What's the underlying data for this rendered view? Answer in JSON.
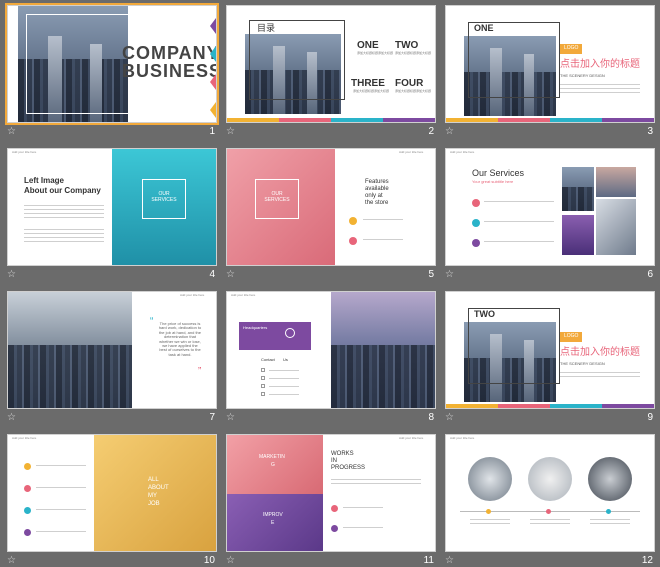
{
  "slides": [
    {
      "num": "1",
      "company": "COMPANY",
      "business": "BUSINESS"
    },
    {
      "num": "2",
      "title": "目录",
      "one": "ONE",
      "two": "TWO",
      "three": "THREE",
      "four": "FOUR",
      "sub": "添加大标题标题添加大标题"
    },
    {
      "num": "3",
      "label": "ONE",
      "logo": "LOGO",
      "cn_title": "点击加入你的标题",
      "subtitle": "THE SCENERY DESIGN"
    },
    {
      "num": "4",
      "header": "Add your title here",
      "title1": "Left Image",
      "title2": "About our Company",
      "box": "OUR SERVICES"
    },
    {
      "num": "5",
      "header": "Add your title here",
      "box": "OUR SERVICES",
      "f1": "Features",
      "f2": "available",
      "f3": "only at",
      "f4": "the store"
    },
    {
      "num": "6",
      "header": "Add your title here",
      "title": "Our Services",
      "sub": "Your great subtitle here"
    },
    {
      "num": "7",
      "header": "Add your title here",
      "quote": "The price of success is hard work, dedication to the job at hand, and the determination that whether we win or lose, we have applied the best of ourselves to the task at hand."
    },
    {
      "num": "8",
      "header": "Add your title here",
      "hq": "Headquarters",
      "contact": "Contact",
      "us": "Us"
    },
    {
      "num": "9",
      "label": "TWO",
      "logo": "LOGO",
      "cn_title": "点击加入你的标题",
      "subtitle": "THE SCENERY DESIGN"
    },
    {
      "num": "10",
      "header": "Add your title here",
      "all": "ALL",
      "about": "ABOUT",
      "my": "MY",
      "job": "JOB"
    },
    {
      "num": "11",
      "header": "Add your title here",
      "marketing": "MARKETIN",
      "g": "G",
      "improv": "IMPROV",
      "e": "E",
      "w1": "WORKS",
      "w2": "IN",
      "w3": "PROGRESS"
    },
    {
      "num": "12",
      "header": "Add your title here"
    }
  ],
  "colors": {
    "yellow": "#f2b233",
    "pink": "#e8657a",
    "teal": "#2ab3c9",
    "purple": "#7d4aa0",
    "orange": "#f2a93b"
  }
}
